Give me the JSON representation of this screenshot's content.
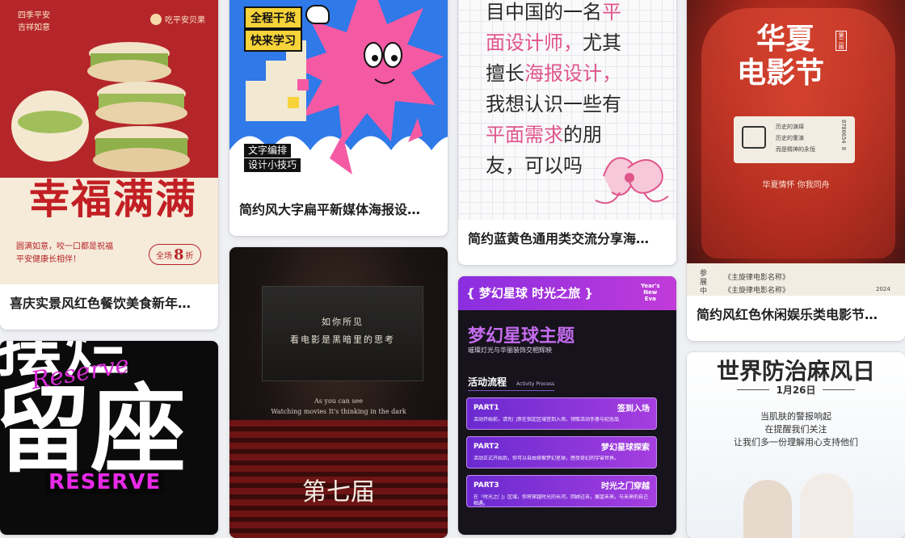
{
  "cards": [
    {
      "caption": "喜庆实景风红色餐饮美食新年…",
      "poster": {
        "top_left": [
          "四季平安",
          "吉祥如意"
        ],
        "brand": "吃平安贝果",
        "headline": "幸福满满",
        "sub": [
          "圆满如意，咬一口都是祝福",
          "平安健康长相伴！"
        ],
        "badge_prefix": "全场",
        "badge_num": "8",
        "badge_suffix": "折"
      }
    },
    {
      "poster": {
        "headline_lines": [
          "摆烂",
          "留座"
        ],
        "script_text": "Reserve",
        "banner": "RESERVE"
      }
    },
    {
      "caption": "简约风大字扁平新媒体海报设…",
      "poster": {
        "tag1": "全程干货",
        "tag2": "快来学习",
        "tag3": "文字编排",
        "tag4": "设计小技巧"
      }
    },
    {
      "poster": {
        "screen_lines": [
          "如你所见",
          "看电影是黑暗里的思考"
        ],
        "english": [
          "As you can see",
          "Watching movies It's thinking in the dark"
        ],
        "title": "第七届"
      }
    },
    {
      "caption": "简约蓝黄色通用类交流分享海…",
      "poster": {
        "lines": [
          {
            "parts": [
              {
                "t": "目中国的一名",
                "c": "ink"
              },
              {
                "t": "平",
                "c": "pink"
              }
            ]
          },
          {
            "parts": [
              {
                "t": "面设计师，",
                "c": "pink"
              },
              {
                "t": "尤其",
                "c": "ink"
              }
            ]
          },
          {
            "parts": [
              {
                "t": "擅长",
                "c": "ink"
              },
              {
                "t": "海报设计，",
                "c": "pink"
              }
            ]
          },
          {
            "parts": [
              {
                "t": "我想认识一些有",
                "c": "ink"
              }
            ]
          },
          {
            "parts": [
              {
                "t": "平面需求",
                "c": "pink"
              },
              {
                "t": "的朋",
                "c": "ink"
              }
            ]
          },
          {
            "parts": [
              {
                "t": "友，可以吗",
                "c": "ink"
              }
            ]
          }
        ]
      }
    },
    {
      "poster": {
        "header": "{ 梦幻星球 时光之旅 }",
        "corner": [
          "Year's",
          "New",
          "Eva"
        ],
        "title": "梦幻星球主题",
        "subtitle": "璀璨灯光与华丽装饰交相辉映",
        "flow_label": "活动流程",
        "flow_en": "Activity Process",
        "parts": [
          {
            "part": "PART1",
            "name": "签到入场",
            "desc": "活动开始前，请先门票在指定区域签到入场，领取活动手册与纪念品"
          },
          {
            "part": "PART2",
            "name": "梦幻星球探索",
            "desc": "活动正式开始后，你可以自由探索梦幻星球，感受奇幻的宇宙世界。"
          },
          {
            "part": "PART3",
            "name": "时光之门穿越",
            "desc": "在「时光之门」区域，你将穿越时光的长河，回顾过去，展望未来。与未来的自己相遇。"
          }
        ]
      }
    },
    {
      "caption": "简约风红色休闲娱乐类电影节…",
      "poster": {
        "title": [
          "华夏",
          "电影节"
        ],
        "edition": "第二届",
        "ticket_lines": [
          "历史的演绎",
          "历史的重演",
          "而是精神的永恒"
        ],
        "ticket_no": "0780654 8",
        "slogan": "华夏情怀  你我同舟",
        "side": [
          "参",
          "展",
          "中"
        ],
        "items": [
          "《主旋律电影名称》",
          "《主旋律电影名称》"
        ],
        "year": "2024"
      }
    },
    {
      "poster": {
        "title": "世界防治麻风日",
        "date": "1月26日",
        "lines": [
          "当肌肤的警报响起",
          "在提醒我们关注",
          "让我们多一份理解用心支持他们"
        ]
      }
    }
  ]
}
